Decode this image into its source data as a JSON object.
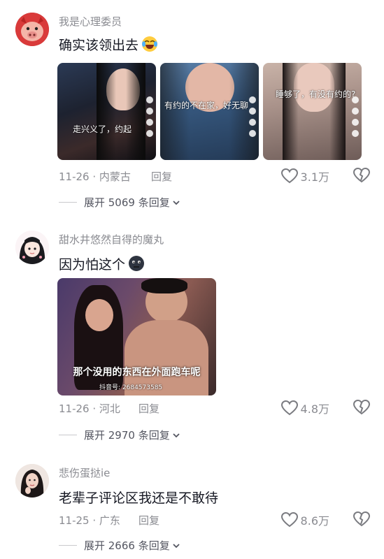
{
  "comments": [
    {
      "username": "我是心理委员",
      "text": "确实该领出去",
      "emoji": "crying-laughing-emoji",
      "images": [
        {
          "caption": "走兴义了，约起"
        },
        {
          "caption": "有约的不在家，好无聊"
        },
        {
          "caption": "睡够了，有没有约的?"
        }
      ],
      "date_location": "11-26 · 内蒙古",
      "reply_label": "回复",
      "likes": "3.1万",
      "expand_label": "展开 5069 条回复"
    },
    {
      "username": "甜水井悠然自得的魔丸",
      "text": "因为怕这个",
      "emoji": "dark-face-emoji",
      "image": {
        "subtitle": "那个没用的东西在外面跑车呢",
        "watermark": "抖音号: 2684573585"
      },
      "date_location": "11-26 · 河北",
      "reply_label": "回复",
      "likes": "4.8万",
      "expand_label": "展开 2970 条回复"
    },
    {
      "username": "悲伤蛋挞ie",
      "text": "老辈子评论区我还是不敢待",
      "date_location": "11-25 · 广东",
      "reply_label": "回复",
      "likes": "8.6万",
      "expand_label": "展开 2666 条回复"
    }
  ]
}
